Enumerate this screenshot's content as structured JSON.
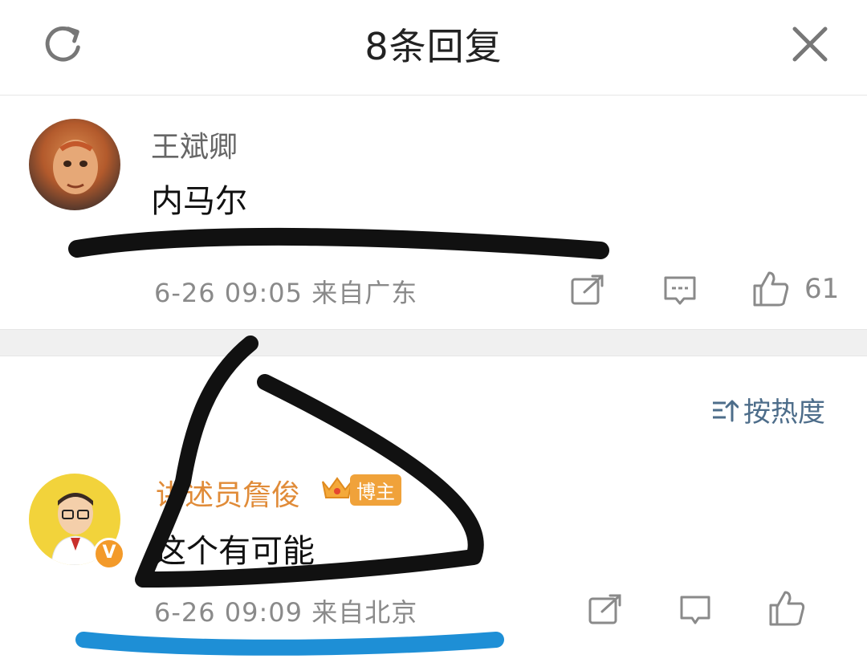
{
  "header": {
    "title": "8条回复",
    "refresh_icon": "refresh-icon",
    "close_icon": "close-icon"
  },
  "comments": [
    {
      "username": "王斌卿",
      "text": "内马尔",
      "meta": "6-26 09:05 来自广东",
      "likes": "61"
    },
    {
      "username": "讲述员詹俊",
      "badge": "博主",
      "text": "这个有可能",
      "meta": "6-26 09:09 来自北京"
    }
  ],
  "sort": {
    "label": "按热度"
  },
  "colors": {
    "username_primary": "#e08b38",
    "sort_link": "#4d6d8a",
    "badge": "#f0a23a",
    "blue_mark": "#1e8fd6"
  }
}
